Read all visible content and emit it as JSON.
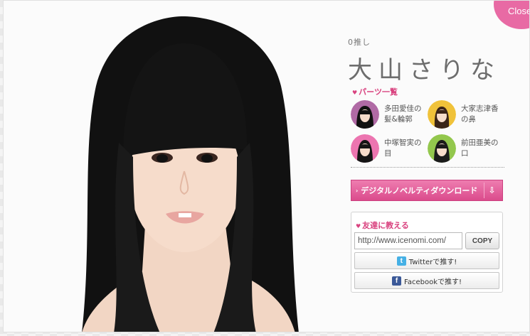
{
  "close": {
    "label": "Close"
  },
  "profile": {
    "oshi": "0推し",
    "name": "大山さりな"
  },
  "parts": {
    "heading": "パーツ一覧",
    "items": [
      {
        "label": "多田愛佳の髪&輪郭",
        "thumb_color": "#b06aa5"
      },
      {
        "label": "大家志津香の鼻",
        "thumb_color": "#f0c23a"
      },
      {
        "label": "中塚智実の目",
        "thumb_color": "#ec75b0"
      },
      {
        "label": "前田亜美の口",
        "thumb_color": "#93c74d"
      }
    ]
  },
  "download": {
    "label": "デジタルノベルティダウンロード"
  },
  "share": {
    "heading": "友達に教える",
    "url_value": "http://www.icenomi.com/",
    "copy_label": "COPY",
    "twitter_label": "Twitterで推す!",
    "facebook_label": "Facebookで推す!"
  },
  "colors": {
    "accent": "#e86aa4",
    "text": "#6d6d6d"
  }
}
